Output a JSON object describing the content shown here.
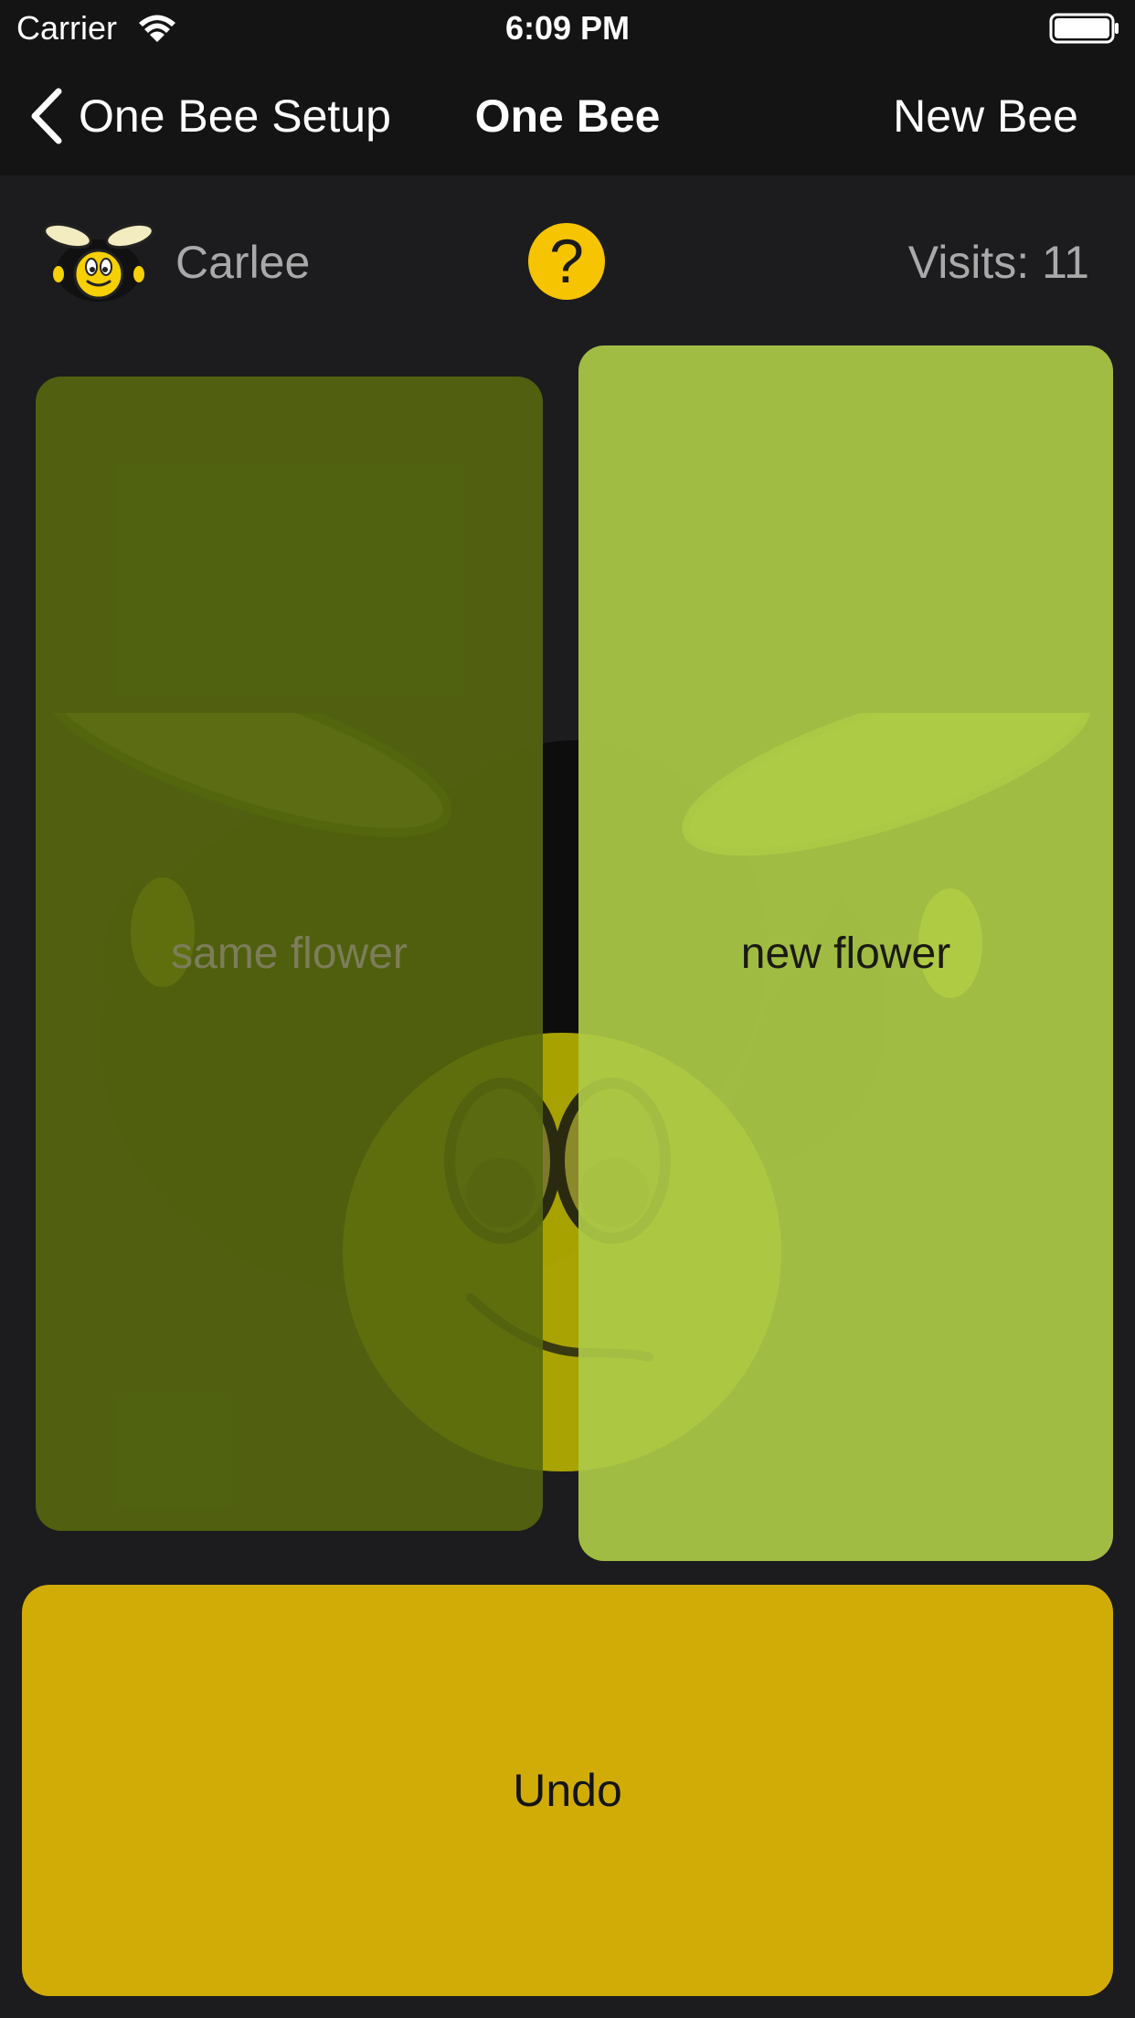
{
  "status_bar": {
    "carrier": "Carrier",
    "time": "6:09 PM"
  },
  "nav": {
    "back_label": "One Bee Setup",
    "title": "One Bee",
    "right_button": "New Bee"
  },
  "bee": {
    "name": "Carlee",
    "visits_text": "Visits: 11"
  },
  "help": {
    "label": "?"
  },
  "buttons": {
    "same_flower": "same flower",
    "new_flower": "new flower",
    "undo": "Undo"
  },
  "colors": {
    "accent_yellow": "#f6c400",
    "same_flower_green": "#56680e",
    "new_flower_green": "#acca46",
    "undo_gold": "#d2ac06",
    "background": "#1c1c1e"
  },
  "icons": {
    "wifi": "wifi-icon",
    "battery": "battery-icon",
    "back": "chevron-left-icon",
    "avatar": "bee-icon",
    "help": "question-icon"
  }
}
